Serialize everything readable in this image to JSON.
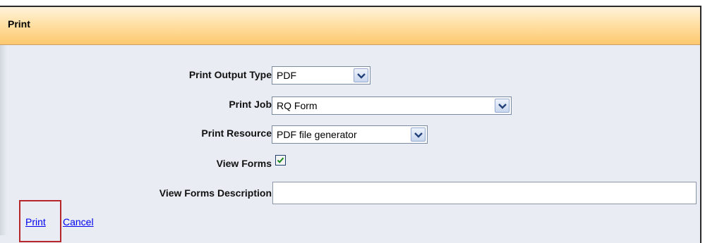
{
  "header": {
    "title": "Print"
  },
  "form": {
    "output_type": {
      "label": "Print Output Type",
      "value": "PDF"
    },
    "print_job": {
      "label": "Print Job",
      "value": "RQ Form"
    },
    "print_resource": {
      "label": "Print Resource",
      "value": "PDF file generator"
    },
    "view_forms": {
      "label": "View Forms",
      "checked": true
    },
    "view_forms_description": {
      "label": "View Forms Description",
      "value": ""
    }
  },
  "actions": {
    "print_label": "Print",
    "cancel_label": "Cancel"
  },
  "icons": {
    "dropdown": "chevron-down-icon",
    "check": "checkmark-icon"
  },
  "colors": {
    "header_accent": "#fcc86e",
    "link": "#0000ee",
    "highlight": "#b6262a",
    "check": "#1c8a1c"
  }
}
